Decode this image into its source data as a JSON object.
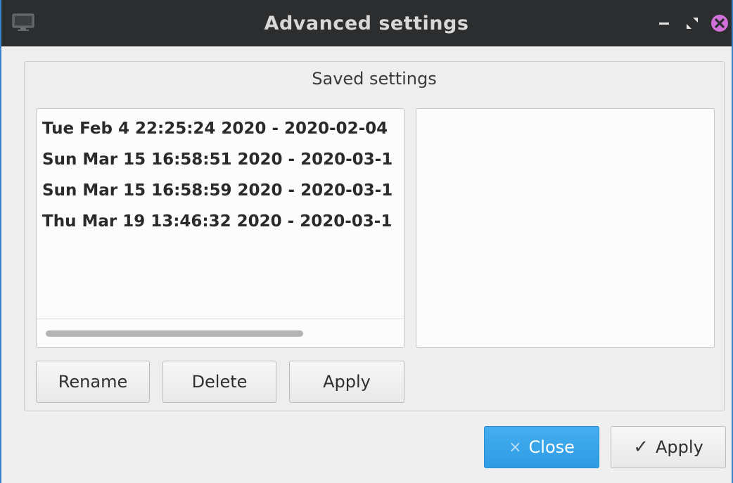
{
  "window": {
    "title": "Advanced settings",
    "accent": "#3b82c4",
    "titlebar_bg": "#2b2d2f"
  },
  "titlebar_buttons": {
    "minimize_icon": "minimize-icon",
    "maximize_icon": "maximize-icon",
    "close_icon": "close-icon",
    "close_color": "#d070d8"
  },
  "saved_settings": {
    "group_title": "Saved settings",
    "items": [
      "Tue Feb 4 22:25:24 2020 - 2020-02-04",
      "Sun Mar 15 16:58:51 2020 - 2020-03-1",
      "Sun Mar 15 16:58:59 2020 - 2020-03-1",
      "Thu Mar 19 13:46:32 2020 - 2020-03-1"
    ],
    "buttons": {
      "rename": "Rename",
      "delete": "Delete",
      "apply": "Apply"
    }
  },
  "dialog_buttons": {
    "close": "Close",
    "close_glyph": "×",
    "apply": "Apply",
    "apply_glyph": "✓",
    "close_color": "#3aa5ea"
  }
}
